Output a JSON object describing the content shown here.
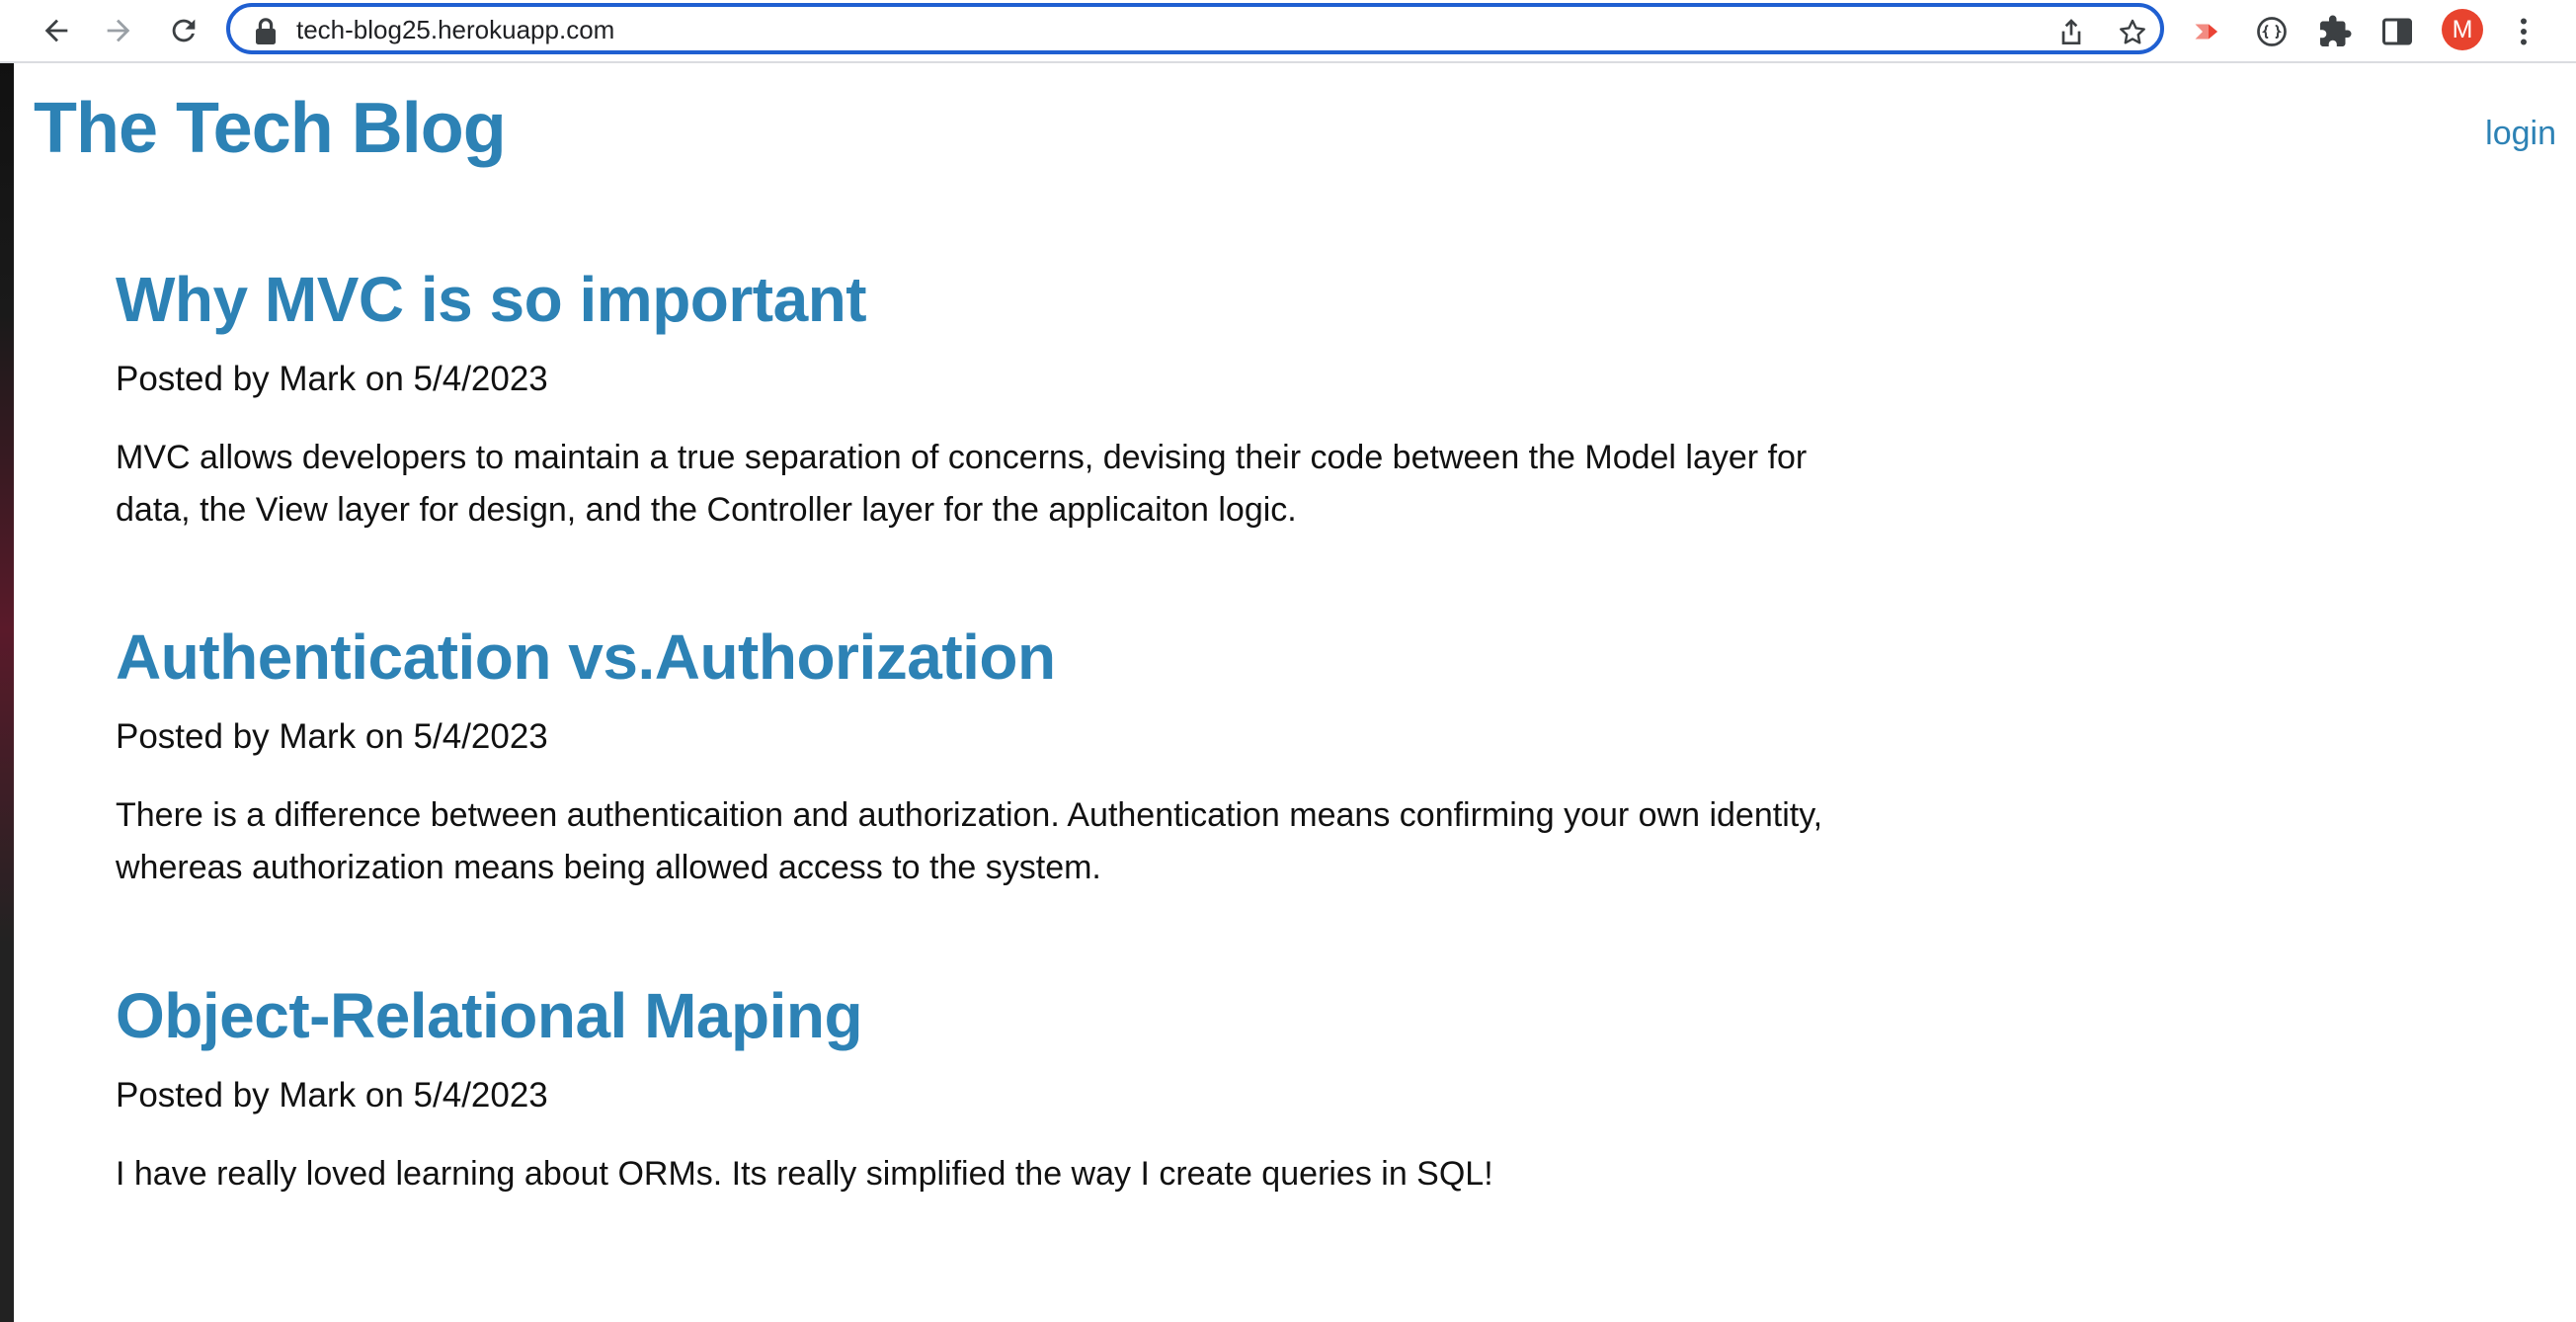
{
  "browser": {
    "url": "tech-blog25.herokuapp.com",
    "profile_initial": "M",
    "icons": {
      "back": "arrow-left-icon",
      "forward": "arrow-right-icon",
      "reload": "reload-icon",
      "lock": "lock-icon",
      "share": "share-icon",
      "bookmark": "star-icon",
      "extension1": "extension-arrow-icon",
      "extension2": "circle-braces-icon",
      "extensions": "puzzle-icon",
      "side_panel": "side-panel-icon",
      "menu": "kebab-menu-icon"
    },
    "colors": {
      "omnibox_border": "#1f5fd1",
      "avatar_bg": "#e8432e"
    }
  },
  "site": {
    "title": "The Tech Blog",
    "login_label": "login",
    "accent_color": "#2d82b5"
  },
  "posts": [
    {
      "title": "Why MVC is so important",
      "meta": "Posted by Mark on 5/4/2023",
      "body": "MVC allows developers to maintain a true separation of concerns, devising their code between the Model layer for data, the View layer for design, and the Controller layer for the applicaiton logic."
    },
    {
      "title": "Authentication vs.Authorization",
      "meta": "Posted by Mark on 5/4/2023",
      "body": "There is a difference between authenticaition and authorization. Authentication means confirming your own identity, whereas authorization means being allowed access to the system."
    },
    {
      "title": "Object-Relational Maping",
      "meta": "Posted by Mark on 5/4/2023",
      "body": "I have really loved learning about ORMs. Its really simplified the way I create queries in SQL!"
    }
  ]
}
